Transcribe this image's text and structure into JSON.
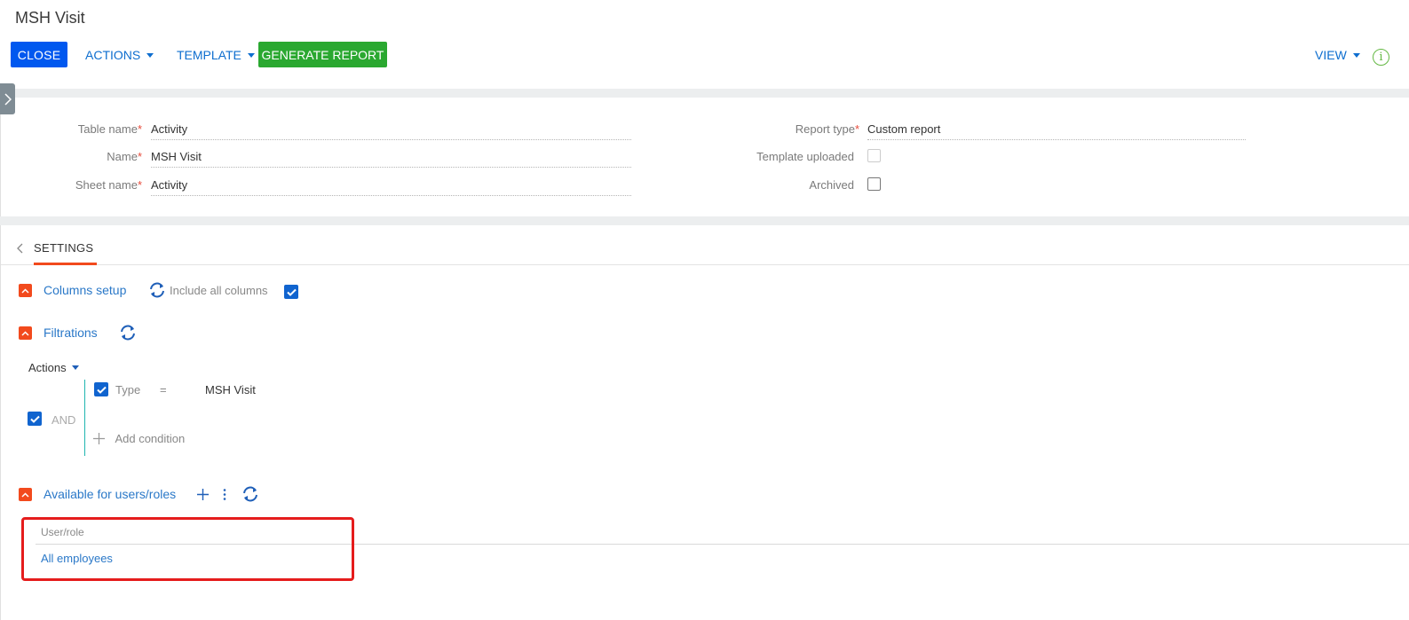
{
  "header": {
    "title": "MSH Visit",
    "close_label": "CLOSE",
    "actions_label": "ACTIONS",
    "template_label": "TEMPLATE",
    "generate_label": "GENERATE REPORT",
    "view_label": "VIEW",
    "info_glyph": "i"
  },
  "form": {
    "table_name_label": "Table name",
    "table_name_value": "Activity",
    "name_label": "Name",
    "name_value": "MSH Visit",
    "sheet_name_label": "Sheet name",
    "sheet_name_value": "Activity",
    "report_type_label": "Report type",
    "report_type_value": "Custom report",
    "template_uploaded_label": "Template uploaded",
    "archived_label": "Archived",
    "required_mark": "*"
  },
  "tabs": {
    "settings_label": "SETTINGS"
  },
  "columns_setup": {
    "title": "Columns setup",
    "include_all_label": "Include all columns"
  },
  "filtrations": {
    "title": "Filtrations",
    "actions_label": "Actions",
    "group_operator": "AND",
    "condition_column": "Type",
    "condition_operator": "=",
    "condition_value": "MSH Visit",
    "add_condition_label": "Add condition"
  },
  "available": {
    "title": "Available for users/roles",
    "column_header": "User/role",
    "rows": [
      "All employees"
    ]
  },
  "colors": {
    "primary": "#0058ef",
    "success": "#2aa830",
    "accent": "#f24a1d",
    "link": "#2a78c8",
    "highlight": "#e51c1c"
  }
}
